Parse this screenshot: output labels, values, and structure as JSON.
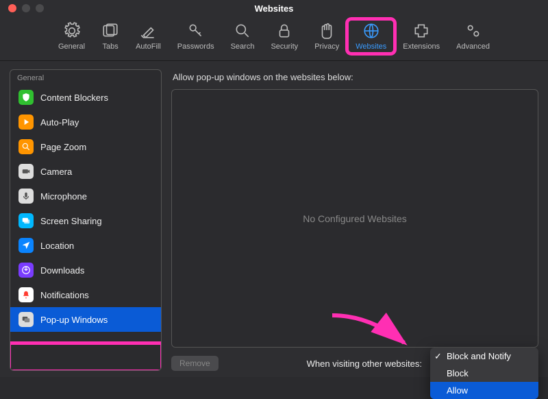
{
  "title": "Websites",
  "tabs": {
    "general": "General",
    "tabs": "Tabs",
    "autofill": "AutoFill",
    "passwords": "Passwords",
    "search": "Search",
    "security": "Security",
    "privacy": "Privacy",
    "websites": "Websites",
    "extensions": "Extensions",
    "advanced": "Advanced"
  },
  "sidebar": {
    "group": "General",
    "items": [
      {
        "label": "Content Blockers"
      },
      {
        "label": "Auto-Play"
      },
      {
        "label": "Page Zoom"
      },
      {
        "label": "Camera"
      },
      {
        "label": "Microphone"
      },
      {
        "label": "Screen Sharing"
      },
      {
        "label": "Location"
      },
      {
        "label": "Downloads"
      },
      {
        "label": "Notifications"
      },
      {
        "label": "Pop-up Windows"
      }
    ]
  },
  "main": {
    "header": "Allow pop-up windows on the websites below:",
    "empty": "No Configured Websites",
    "remove": "Remove",
    "visiting_label": "When visiting other websites:",
    "dropdown": {
      "block_notify": "Block and Notify",
      "block": "Block",
      "allow": "Allow"
    },
    "help": "?"
  }
}
